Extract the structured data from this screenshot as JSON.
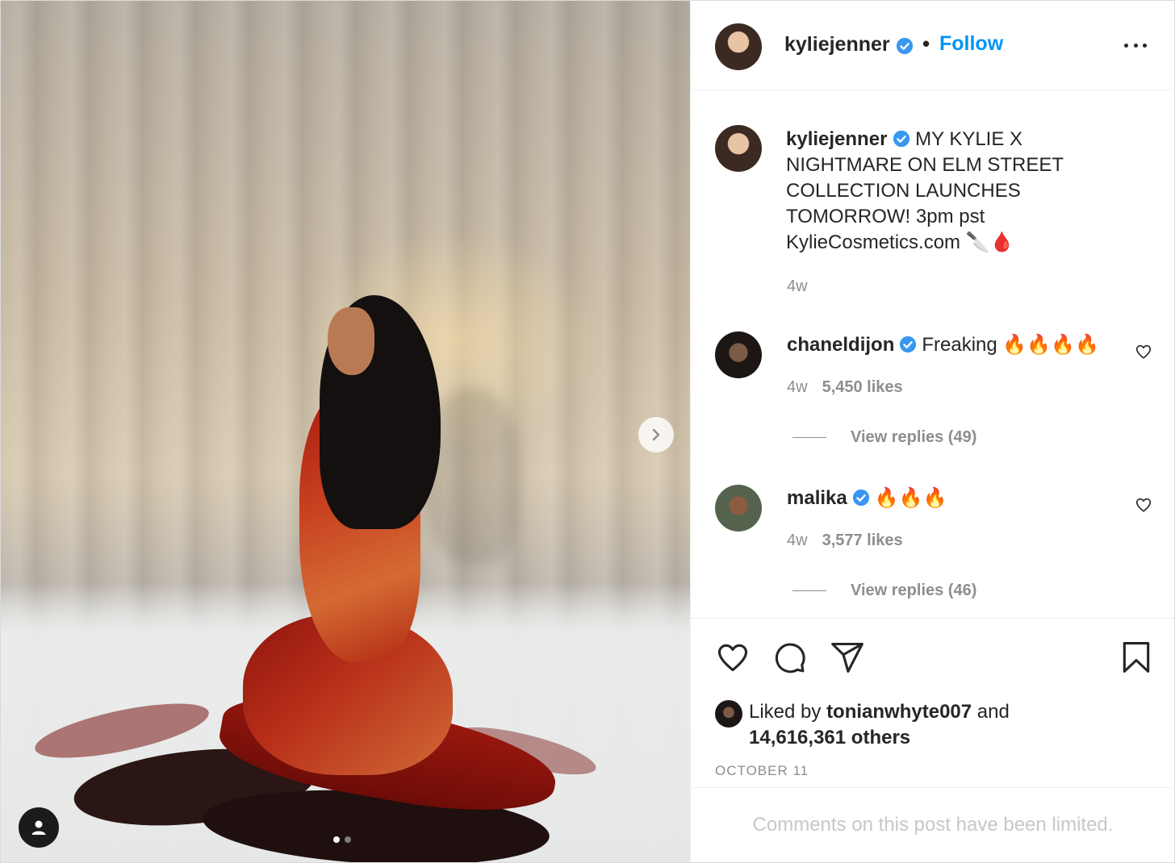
{
  "header": {
    "username": "kyliejenner",
    "separator": "•",
    "follow_label": "Follow",
    "verified_icon": "verified-badge-icon"
  },
  "caption": {
    "username": "kyliejenner",
    "text": "MY KYLIE X NIGHTMARE ON ELM STREET COLLECTION LAUNCHES TOMORROW! 3pm pst KylieCosmetics.com 🔪🩸",
    "time": "4w"
  },
  "comments": [
    {
      "username": "chaneldijon",
      "text": "Freaking 🔥🔥🔥🔥",
      "time": "4w",
      "likes": "5,450 likes",
      "replies": "View replies (49)"
    },
    {
      "username": "malika",
      "text": "🔥🔥🔥",
      "time": "4w",
      "likes": "3,577 likes",
      "replies": "View replies (46)"
    }
  ],
  "actions": {
    "like_icon": "heart-icon",
    "comment_icon": "comment-icon",
    "share_icon": "send-icon",
    "save_icon": "bookmark-icon"
  },
  "likes": {
    "prefix": "Liked by",
    "user": "tonianwhyte007",
    "middle": "and",
    "others": "14,616,361 others"
  },
  "date": "OCTOBER 11",
  "comments_limited": "Comments on this post have been limited.",
  "carousel": {
    "current": 1,
    "total": 2
  },
  "colors": {
    "accent": "#0095f6",
    "verified": "#3897f0",
    "muted": "#8e8e8e"
  }
}
